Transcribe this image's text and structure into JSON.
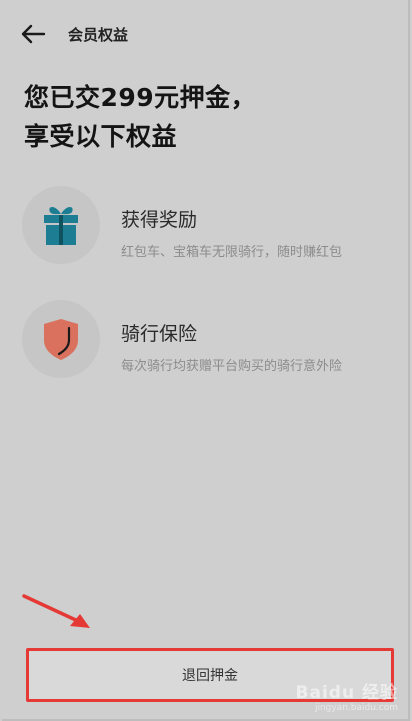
{
  "header": {
    "title": "会员权益"
  },
  "headline": {
    "line1": "您已交299元押金，",
    "line2": "享受以下权益"
  },
  "benefits": [
    {
      "icon": "gift-icon",
      "title": "获得奖励",
      "desc": "红包车、宝箱车无限骑行，随时赚红包"
    },
    {
      "icon": "shield-icon",
      "title": "骑行保险",
      "desc": "每次骑行均获赠平台购买的骑行意外险"
    }
  ],
  "refund_button": {
    "label": "退回押金"
  },
  "watermark": {
    "logo": "Baidu 经验",
    "url": "jingyan.baidu.com"
  },
  "colors": {
    "highlight": "#e53935",
    "gift": "#1d7d92",
    "shield": "#d9715e"
  }
}
